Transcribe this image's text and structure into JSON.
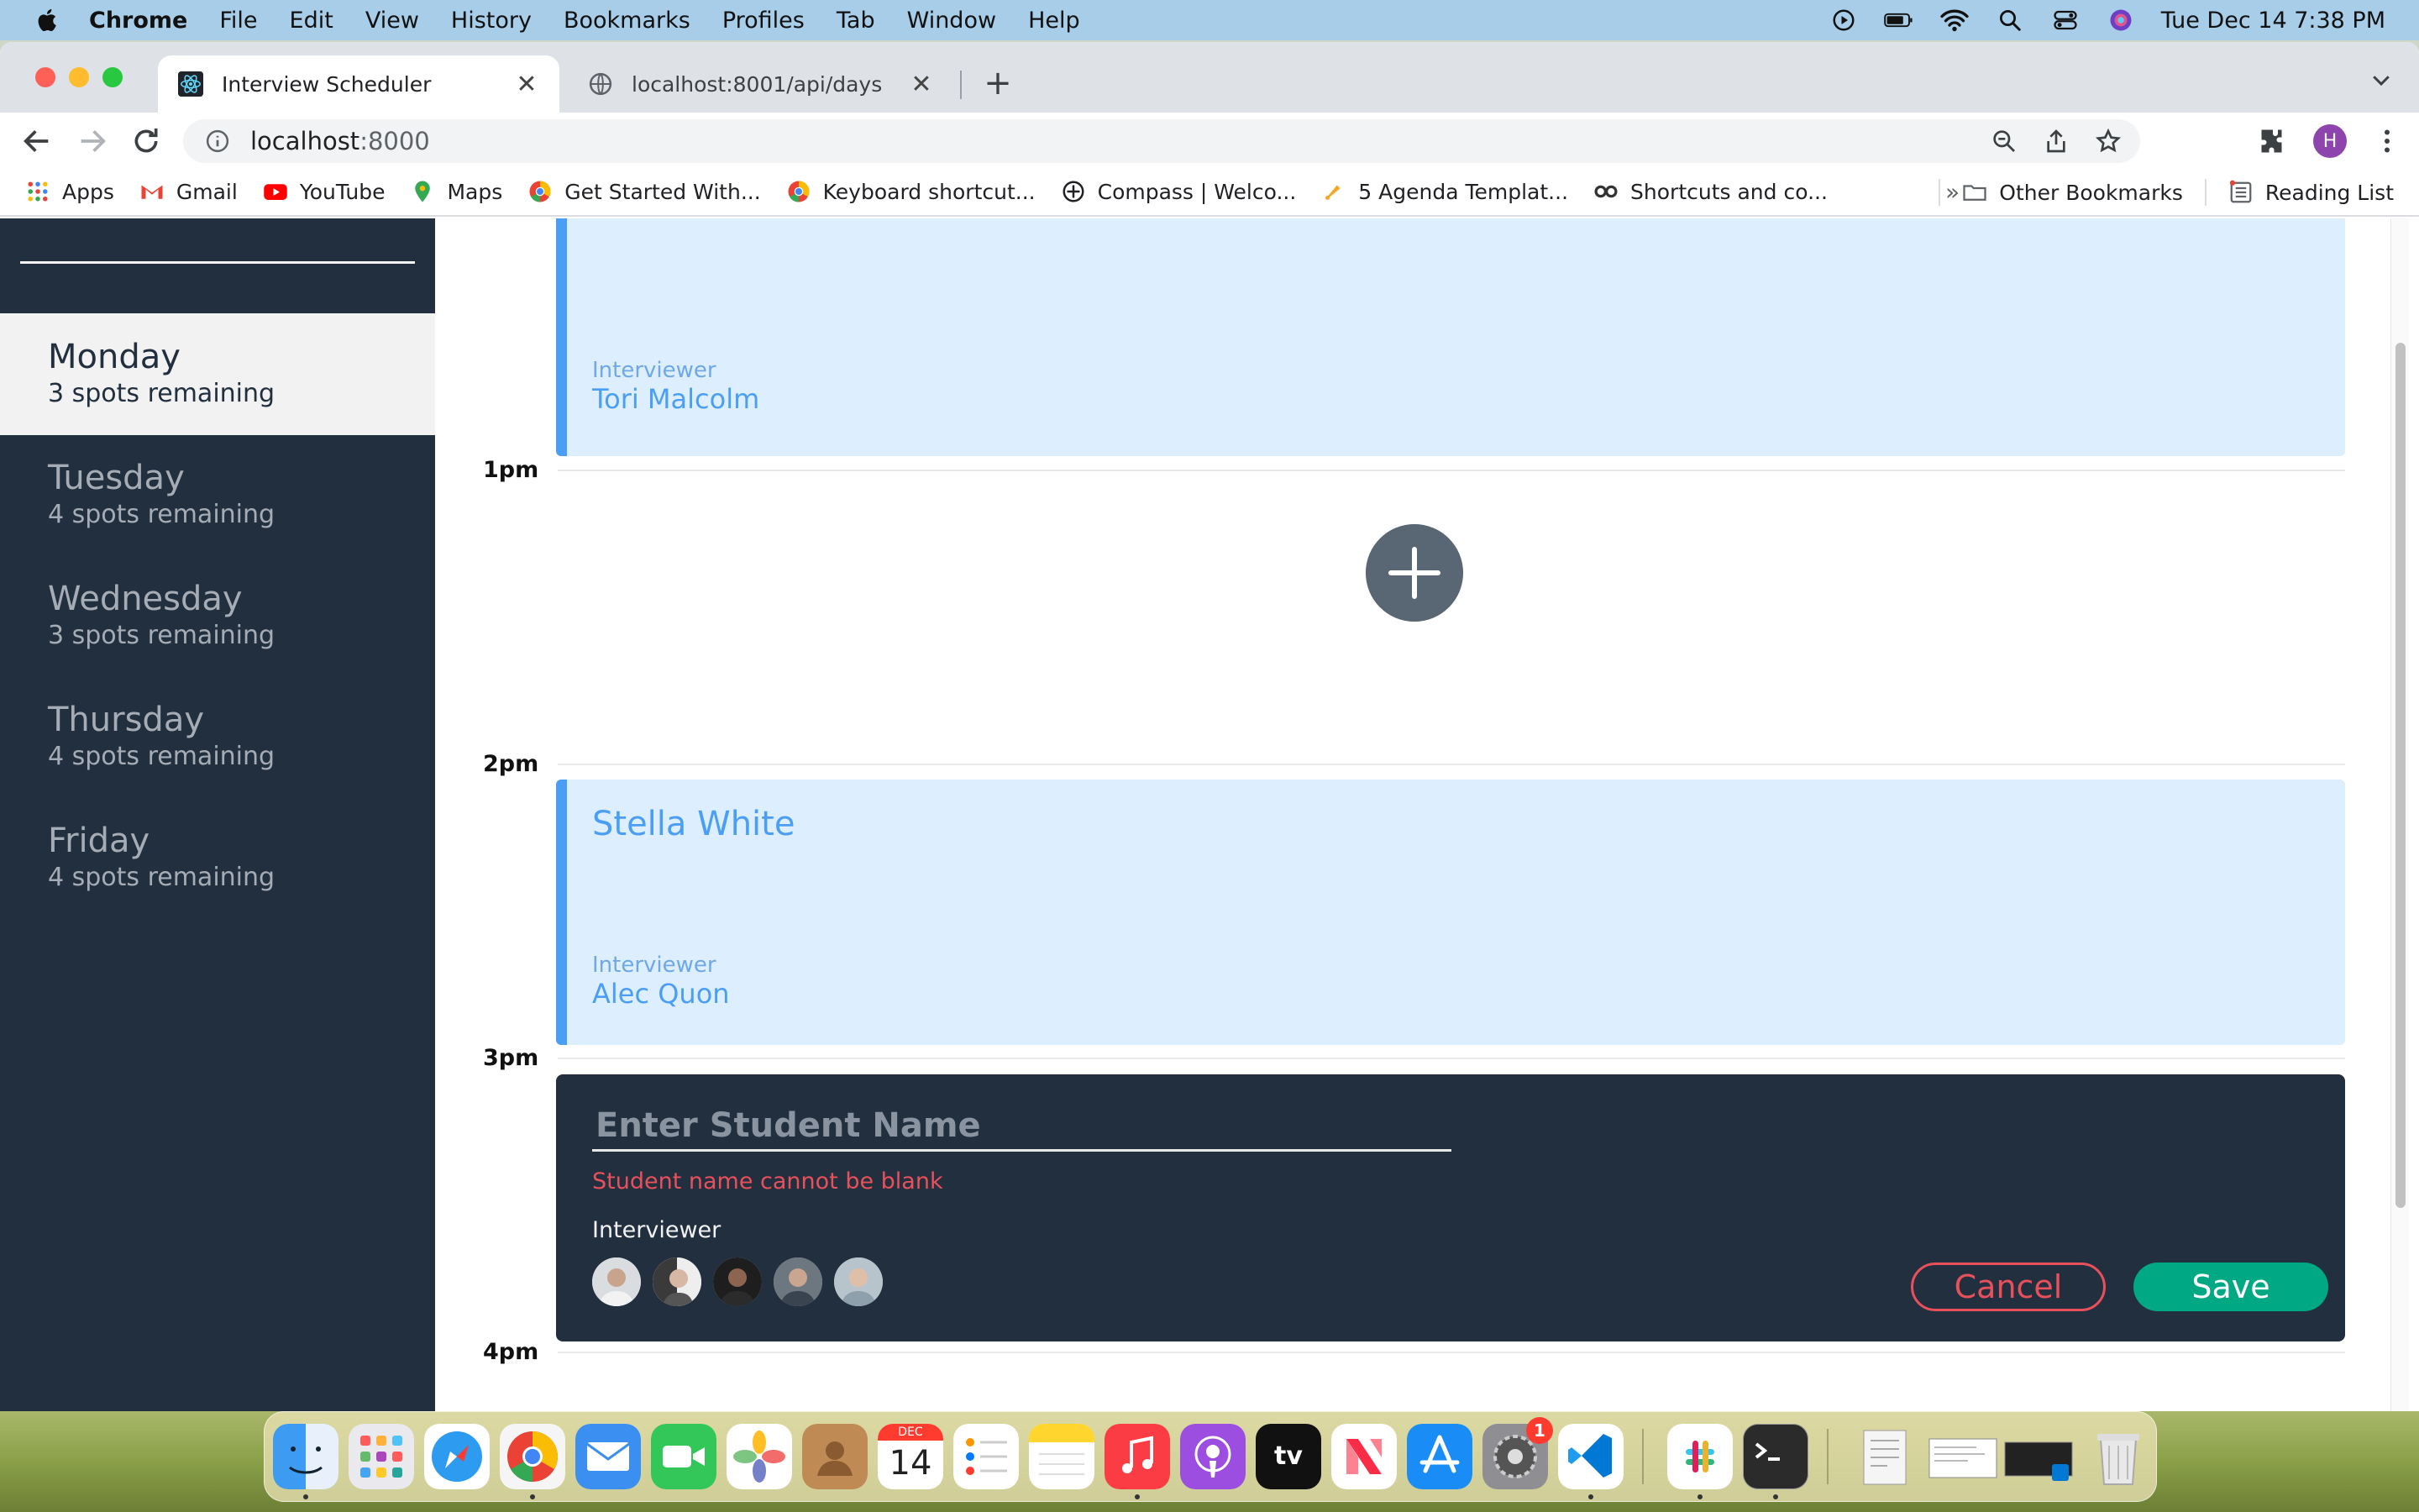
{
  "menubar": {
    "app": "Chrome",
    "items": [
      "File",
      "Edit",
      "View",
      "History",
      "Bookmarks",
      "Profiles",
      "Tab",
      "Window",
      "Help"
    ],
    "clock": "Tue Dec 14  7:38 PM"
  },
  "browser": {
    "tabs": [
      {
        "title": "Interview Scheduler",
        "active": true
      },
      {
        "title": "localhost:8001/api/days",
        "active": false
      }
    ],
    "address": {
      "host": "localhost",
      "port": ":8000"
    },
    "profile_initial": "H",
    "bookmarks": [
      "Apps",
      "Gmail",
      "YouTube",
      "Maps",
      "Get Started With...",
      "Keyboard shortcut...",
      "Compass | Welco...",
      "5 Agenda Templat...",
      "Shortcuts and co..."
    ],
    "bookmarks_overflow": "»",
    "other_bookmarks": "Other Bookmarks",
    "reading_list": "Reading List"
  },
  "sidebar": {
    "days": [
      {
        "name": "Monday",
        "spots": "3 spots remaining",
        "selected": true
      },
      {
        "name": "Tuesday",
        "spots": "4 spots remaining",
        "selected": false
      },
      {
        "name": "Wednesday",
        "spots": "3 spots remaining",
        "selected": false
      },
      {
        "name": "Thursday",
        "spots": "4 spots remaining",
        "selected": false
      },
      {
        "name": "Friday",
        "spots": "4 spots remaining",
        "selected": false
      }
    ]
  },
  "schedule": {
    "hours": [
      "1pm",
      "2pm",
      "3pm",
      "4pm"
    ],
    "appointments": [
      {
        "student": "",
        "interviewer_label": "Interviewer",
        "interviewer": "Tori Malcolm"
      },
      {
        "student": "Stella White",
        "interviewer_label": "Interviewer",
        "interviewer": "Alec Quon"
      }
    ],
    "form": {
      "placeholder": "Enter Student Name",
      "error": "Student name cannot be blank",
      "interviewer_heading": "Interviewer",
      "cancel": "Cancel",
      "save": "Save"
    }
  },
  "dock": {
    "calendar_month": "DEC",
    "calendar_day": "14",
    "settings_badge": "1",
    "tv_label": "tv"
  },
  "colors": {
    "sidebar_bg": "#222f3e",
    "appointment_bg": "#ddeeff",
    "accent_blue": "#4a9ff5",
    "error_red": "#e8505b",
    "save_green": "#00a884"
  }
}
